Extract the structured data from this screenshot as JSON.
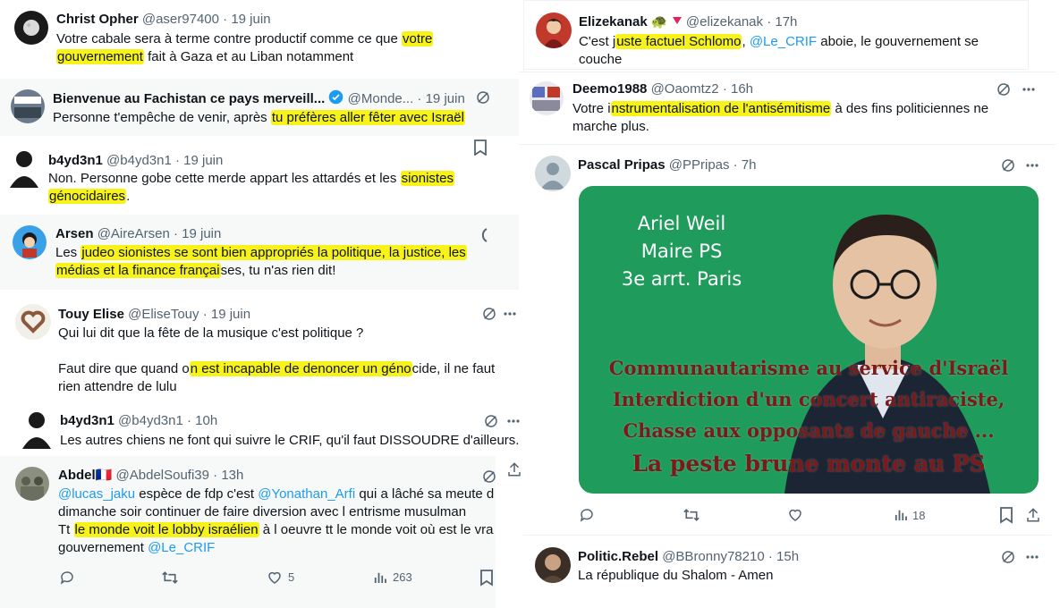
{
  "colors": {
    "highlight": "#f6f21a",
    "mention": "#1d9bf0",
    "secondary": "#536471",
    "verified": "#1d9bf0",
    "media_bg": "#1f9b5c"
  },
  "left": {
    "t1": {
      "name": "Christ Opher",
      "handle": "@aser97400",
      "dot": "·",
      "time": "19 juin",
      "l1a": "Votre cabale sera à terme contre productif comme ce que ",
      "l1h": "votre",
      "l2h": "gouvernement",
      "l2b": " fait à Gaza et au Liban notamment"
    },
    "t2": {
      "name": "Bienvenue au Fachistan ce pays merveill...",
      "handle": "@Monde...",
      "dot": "·",
      "time": "19 juin",
      "l1a": "Personne t'empêche de venir, après ",
      "l1h": "tu préfères aller fêter avec Israël"
    },
    "t3": {
      "name": "b4yd3n1",
      "handle": "@b4yd3n1",
      "dot": "·",
      "time": "19 juin",
      "l1a": "Non. Personne gobe cette merde appart les attardés et les ",
      "l1h": "sionistes",
      "l2h": "génocidaires",
      "l2b": "."
    },
    "t4": {
      "name": "Arsen",
      "handle": "@AireArsen",
      "dot": "·",
      "time": "19 juin",
      "l1a": "Les ",
      "l1h": "judeo sionistes se sont bien appropriés la politique, la justice, les",
      "l2h": "médias et la finance françai",
      "l2b": "ses, tu n'as rien dit!"
    },
    "t5": {
      "name": "Touy Elise",
      "handle": "@EliseTouy",
      "dot": "·",
      "time": "19 juin",
      "l1": "Qui lui dit que la fête de la musique c'est politique ?",
      "l2a": "Faut dire que quand o",
      "l2h": "n est incapable de denoncer un géno",
      "l2b": "cide, il ne faut",
      "l3": "rien attendre de lulu"
    },
    "t6": {
      "name": "b4yd3n1",
      "handle": "@b4yd3n1",
      "dot": "·",
      "time": "10h",
      "l1": "Les autres chiens ne font qui suivre le CRIF, qu'il faut DISSOUDRE d'ailleurs."
    },
    "t7": {
      "name": "Abdel",
      "flag": "🇫🇷",
      "handle": "@AbdelSoufi39",
      "dot": "·",
      "time": "13h",
      "m1": "@lucas_jaku",
      "l1b": " espèce de fdp c'est ",
      "m2": "@Yonathan_Arfi",
      "l1c": " qui a lâché sa meute d",
      "l2": "dimanche soir continuer de faire diversion avec l entrisme musulman",
      "l3a": "Tt ",
      "l3h": "le monde voit le lobby israélien",
      "l3b": " à l oeuvre tt le monde voit où est le vra",
      "l4a": "gouvernement ",
      "m3": "@Le_CRIF",
      "likes": "5",
      "views": "263"
    }
  },
  "right": {
    "t1": {
      "name": "Elizekanak",
      "emoji": "🐢",
      "handle": "@elizekanak",
      "dot": "·",
      "time": "17h",
      "l1a": "C'est j",
      "l1h": "uste factuel Schlomo",
      "l1b": ",  ",
      "m1": "@Le_CRIF",
      "l1c": " aboie, le gouvernement se",
      "l2": "couche"
    },
    "t2": {
      "name": "Deemo1988",
      "handle": "@Oaomtz2",
      "dot": "·",
      "time": "16h",
      "l1a": "Votre i",
      "l1h": "nstrumentalisation de l'antisémitisme",
      "l1b": " à des fins politiciennes ne",
      "l2": "marche plus."
    },
    "t3": {
      "name": "Pascal Pripas",
      "handle": "@PPripas",
      "dot": "·",
      "time": "7h",
      "img_line1": "Ariel Weil",
      "img_line2": "Maire PS",
      "img_line3": "3e arrt. Paris",
      "img_r1": "Communautarisme au service d'Israël",
      "img_r2": "Interdiction d'un concert antiraciste,",
      "img_r3": "Chasse aux opposants de gauche ...",
      "img_r4": "La peste brune monte au PS",
      "views": "18"
    },
    "t4": {
      "name": "Politic.Rebel",
      "handle": "@BBronny78210",
      "dot": "·",
      "time": "15h",
      "l1": "La république du Shalom - Amen"
    }
  }
}
